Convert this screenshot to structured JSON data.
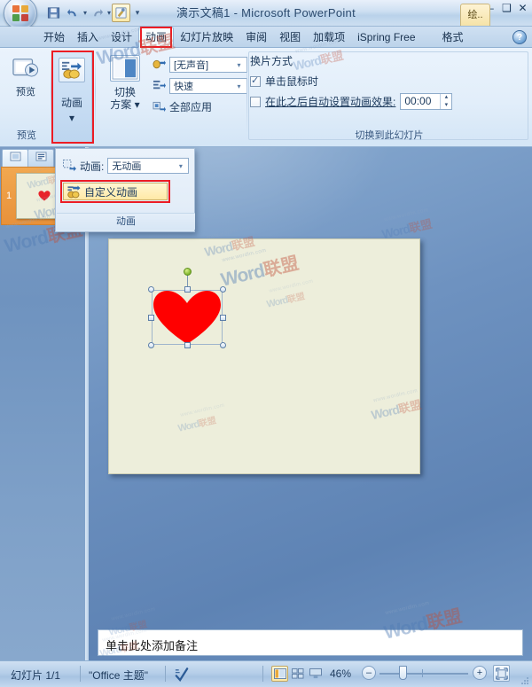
{
  "window": {
    "title": "演示文稿1 - Microsoft PowerPoint",
    "minimize": "–",
    "maximize": "❑",
    "close": "✕",
    "contextual_tab": "绘..",
    "help_label": "?"
  },
  "quick_access": {
    "save_icon": "save-icon",
    "undo_icon": "undo-icon",
    "redo_icon": "redo-icon",
    "custom_tool_icon": "custom-tool-icon",
    "more_icon": "more-commands-icon"
  },
  "tabs": [
    {
      "label": "开始",
      "active": false
    },
    {
      "label": "插入",
      "active": false
    },
    {
      "label": "设计",
      "active": false
    },
    {
      "label": "动画",
      "active": true,
      "highlight": true
    },
    {
      "label": "幻灯片放映",
      "active": false
    },
    {
      "label": "审阅",
      "active": false
    },
    {
      "label": "视图",
      "active": false
    },
    {
      "label": "加载项",
      "active": false
    },
    {
      "label": "iSpring Free",
      "active": false
    },
    {
      "label": "格式",
      "active": false
    }
  ],
  "ribbon": {
    "groups": [
      {
        "name": "preview",
        "label": "预览"
      },
      {
        "name": "animate",
        "label": ""
      },
      {
        "name": "transition",
        "label": ""
      },
      {
        "name": "advance",
        "label": "切换到此幻灯片"
      }
    ],
    "preview_button": {
      "label": "预览",
      "icon": "preview-play-icon"
    },
    "animate_button": {
      "label": "动画",
      "icon": "animation-icon",
      "caret": "▾",
      "highlighted": true
    },
    "transition_scheme_button": {
      "label_line1": "切换",
      "label_line2": "方案",
      "caret": "▾",
      "icon": "transition-scheme-icon"
    },
    "sound_combo": {
      "label_icon": "sound-icon",
      "value": "[无声音]",
      "caret": "▾"
    },
    "speed_combo": {
      "label_icon": "speed-icon",
      "value": "快速",
      "caret": "▾"
    },
    "apply_all": {
      "label": "全部应用",
      "icon": "apply-all-icon"
    },
    "advance_group": {
      "title": "换片方式",
      "on_click": {
        "label": "单击鼠标时",
        "checked": true
      },
      "auto_after": {
        "label": "在此之后自动设置动画效果:",
        "checked": false,
        "value": "00:00"
      },
      "spin_up": "▴",
      "spin_down": "▾"
    }
  },
  "dropdown": {
    "animation_label": "动画:",
    "animation_value": "无动画",
    "animation_caret": "▾",
    "animation_icon": "animate-field-icon",
    "custom_animation": {
      "label": "自定义动画",
      "icon": "custom-animation-icon",
      "highlighted": true
    },
    "footer_label": "动画"
  },
  "left_panel": {
    "tab_slides_icon": "slides-thumbnail-icon",
    "tab_outline_icon": "outline-view-icon",
    "slide_number": "1",
    "thumbnail_shape": "heart-shape"
  },
  "slide": {
    "shape": "heart-shape",
    "shape_color": "#ff0000",
    "selected": true,
    "background": "#edeedb"
  },
  "notes": {
    "placeholder": "单击此处添加备注"
  },
  "status_bar": {
    "slide_indicator": "幻灯片 1/1",
    "theme": "\"Office 主题\"",
    "spell_icon": "spellcheck-icon",
    "view_normal_icon": "view-normal-icon",
    "view_sorter_icon": "view-slide-sorter-icon",
    "view_show_icon": "view-slideshow-icon",
    "zoom_level": "46%",
    "zoom_out": "–",
    "zoom_in": "+",
    "fit_icon": "fit-slide-icon",
    "resize_grip_icon": "resize-grip-icon"
  },
  "watermarks": {
    "brand_word": "Word",
    "brand_cn": "联盟",
    "url": "www.wordlm.com"
  },
  "colors": {
    "accent_red": "#ec1c24",
    "shape_red": "#ff0000",
    "highlight_yellow": "#ffe9a6",
    "slide_bg": "#edeedb",
    "workspace_blue": "#6e92c0",
    "thumb_selected": "#e8913a"
  }
}
